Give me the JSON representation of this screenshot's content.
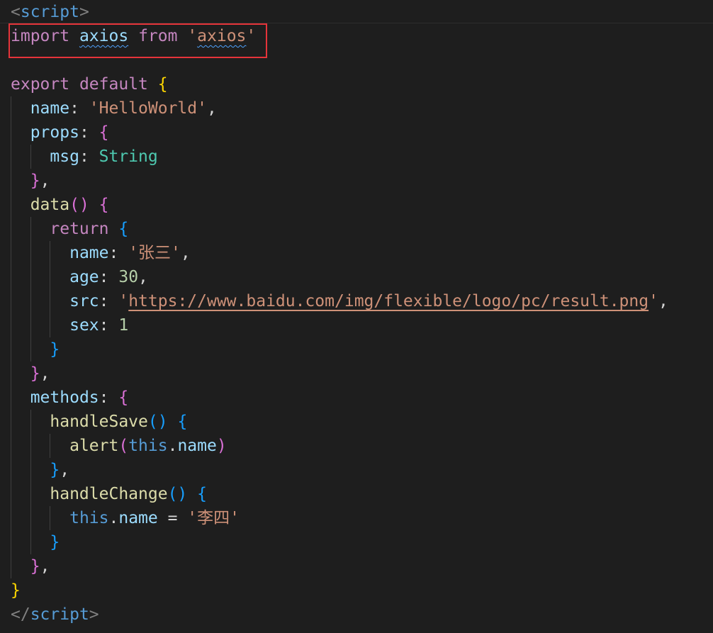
{
  "editor": {
    "colors": {
      "background": "#1e1e1e",
      "tag_bracket": "#808080",
      "tag_name": "#569cd6",
      "keyword": "#c586c0",
      "storage": "#569cd6",
      "identifier": "#9cdcfe",
      "property": "#9cdcfe",
      "function": "#dcdcaa",
      "string": "#ce9178",
      "number": "#b5cea8",
      "type": "#4ec9b0",
      "punct": "#d4d4d4",
      "brace_gold": "#ffd700",
      "brace_purple": "#da70d6",
      "brace_blue": "#179fff",
      "this": "#569cd6",
      "highlight_box": "#e5343a"
    },
    "lines": [
      [
        {
          "t": "<",
          "c": "tag_bracket"
        },
        {
          "t": "script",
          "c": "tag_name"
        },
        {
          "t": ">",
          "c": "tag_bracket"
        }
      ],
      [
        {
          "t": "import",
          "c": "keyword"
        },
        {
          "t": " ",
          "c": "punct"
        },
        {
          "t": "axios",
          "c": "identifier",
          "squiggle": true
        },
        {
          "t": " ",
          "c": "punct"
        },
        {
          "t": "from",
          "c": "keyword"
        },
        {
          "t": " ",
          "c": "punct"
        },
        {
          "t": "'",
          "c": "string"
        },
        {
          "t": "axios",
          "c": "string",
          "squiggle": true
        },
        {
          "t": "'",
          "c": "string"
        }
      ],
      [],
      [
        {
          "t": "export",
          "c": "keyword"
        },
        {
          "t": " ",
          "c": "punct"
        },
        {
          "t": "default",
          "c": "keyword"
        },
        {
          "t": " ",
          "c": "punct"
        },
        {
          "t": "{",
          "c": "brace_gold"
        }
      ],
      [
        {
          "t": "  ",
          "c": "punct"
        },
        {
          "t": "name",
          "c": "property"
        },
        {
          "t": ": ",
          "c": "punct"
        },
        {
          "t": "'HelloWorld'",
          "c": "string"
        },
        {
          "t": ",",
          "c": "punct"
        }
      ],
      [
        {
          "t": "  ",
          "c": "punct"
        },
        {
          "t": "props",
          "c": "property"
        },
        {
          "t": ": ",
          "c": "punct"
        },
        {
          "t": "{",
          "c": "brace_purple"
        }
      ],
      [
        {
          "t": "    ",
          "c": "punct"
        },
        {
          "t": "msg",
          "c": "property"
        },
        {
          "t": ": ",
          "c": "punct"
        },
        {
          "t": "String",
          "c": "type"
        }
      ],
      [
        {
          "t": "  ",
          "c": "punct"
        },
        {
          "t": "}",
          "c": "brace_purple"
        },
        {
          "t": ",",
          "c": "punct"
        }
      ],
      [
        {
          "t": "  ",
          "c": "punct"
        },
        {
          "t": "data",
          "c": "function"
        },
        {
          "t": "()",
          "c": "brace_purple"
        },
        {
          "t": " ",
          "c": "punct"
        },
        {
          "t": "{",
          "c": "brace_purple"
        }
      ],
      [
        {
          "t": "    ",
          "c": "punct"
        },
        {
          "t": "return",
          "c": "keyword"
        },
        {
          "t": " ",
          "c": "punct"
        },
        {
          "t": "{",
          "c": "brace_blue"
        }
      ],
      [
        {
          "t": "      ",
          "c": "punct"
        },
        {
          "t": "name",
          "c": "property"
        },
        {
          "t": ": ",
          "c": "punct"
        },
        {
          "t": "'张三'",
          "c": "string"
        },
        {
          "t": ",",
          "c": "punct"
        }
      ],
      [
        {
          "t": "      ",
          "c": "punct"
        },
        {
          "t": "age",
          "c": "property"
        },
        {
          "t": ": ",
          "c": "punct"
        },
        {
          "t": "30",
          "c": "number"
        },
        {
          "t": ",",
          "c": "punct"
        }
      ],
      [
        {
          "t": "      ",
          "c": "punct"
        },
        {
          "t": "src",
          "c": "property"
        },
        {
          "t": ": ",
          "c": "punct"
        },
        {
          "t": "'",
          "c": "string"
        },
        {
          "t": "https://www.baidu.com/img/flexible/logo/pc/result.png",
          "c": "string",
          "link": true
        },
        {
          "t": "'",
          "c": "string"
        },
        {
          "t": ",",
          "c": "punct"
        }
      ],
      [
        {
          "t": "      ",
          "c": "punct"
        },
        {
          "t": "sex",
          "c": "property"
        },
        {
          "t": ": ",
          "c": "punct"
        },
        {
          "t": "1",
          "c": "number"
        }
      ],
      [
        {
          "t": "    ",
          "c": "punct"
        },
        {
          "t": "}",
          "c": "brace_blue"
        }
      ],
      [
        {
          "t": "  ",
          "c": "punct"
        },
        {
          "t": "}",
          "c": "brace_purple"
        },
        {
          "t": ",",
          "c": "punct"
        }
      ],
      [
        {
          "t": "  ",
          "c": "punct"
        },
        {
          "t": "methods",
          "c": "property"
        },
        {
          "t": ": ",
          "c": "punct"
        },
        {
          "t": "{",
          "c": "brace_purple"
        }
      ],
      [
        {
          "t": "    ",
          "c": "punct"
        },
        {
          "t": "handleSave",
          "c": "function"
        },
        {
          "t": "()",
          "c": "brace_blue"
        },
        {
          "t": " ",
          "c": "punct"
        },
        {
          "t": "{",
          "c": "brace_blue"
        }
      ],
      [
        {
          "t": "      ",
          "c": "punct"
        },
        {
          "t": "alert",
          "c": "function"
        },
        {
          "t": "(",
          "c": "brace_purple"
        },
        {
          "t": "this",
          "c": "this"
        },
        {
          "t": ".",
          "c": "punct"
        },
        {
          "t": "name",
          "c": "property"
        },
        {
          "t": ")",
          "c": "brace_purple"
        }
      ],
      [
        {
          "t": "    ",
          "c": "punct"
        },
        {
          "t": "}",
          "c": "brace_blue"
        },
        {
          "t": ",",
          "c": "punct"
        }
      ],
      [
        {
          "t": "    ",
          "c": "punct"
        },
        {
          "t": "handleChange",
          "c": "function"
        },
        {
          "t": "()",
          "c": "brace_blue"
        },
        {
          "t": " ",
          "c": "punct"
        },
        {
          "t": "{",
          "c": "brace_blue"
        }
      ],
      [
        {
          "t": "      ",
          "c": "punct"
        },
        {
          "t": "this",
          "c": "this"
        },
        {
          "t": ".",
          "c": "punct"
        },
        {
          "t": "name",
          "c": "property"
        },
        {
          "t": " = ",
          "c": "punct"
        },
        {
          "t": "'李四'",
          "c": "string"
        }
      ],
      [
        {
          "t": "    ",
          "c": "punct"
        },
        {
          "t": "}",
          "c": "brace_blue"
        }
      ],
      [
        {
          "t": "  ",
          "c": "punct"
        },
        {
          "t": "}",
          "c": "brace_purple"
        },
        {
          "t": ",",
          "c": "punct"
        }
      ],
      [
        {
          "t": "}",
          "c": "brace_gold"
        }
      ],
      [
        {
          "t": "</",
          "c": "tag_bracket"
        },
        {
          "t": "script",
          "c": "tag_name"
        },
        {
          "t": ">",
          "c": "tag_bracket"
        }
      ]
    ]
  }
}
